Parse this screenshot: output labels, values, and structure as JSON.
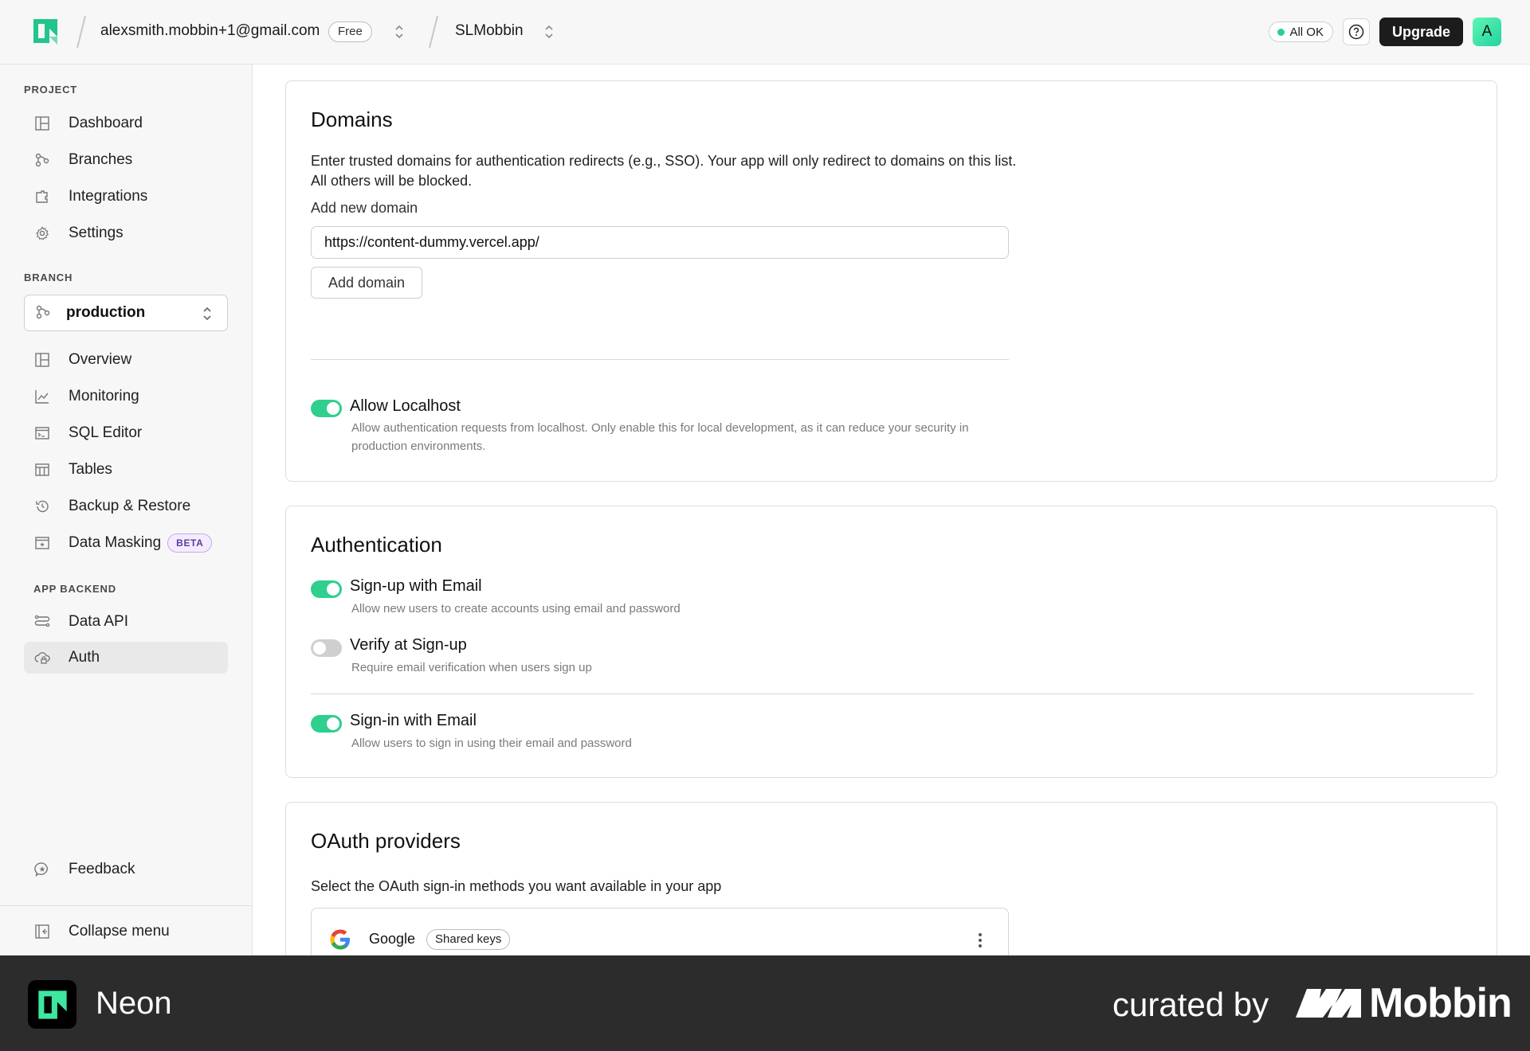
{
  "topbar": {
    "account_email": "alexsmith.mobbin+1@gmail.com",
    "plan_badge": "Free",
    "project_name": "SLMobbin",
    "status_label": "All OK",
    "upgrade_label": "Upgrade",
    "avatar_initial": "A"
  },
  "sidebar": {
    "project_section": "PROJECT",
    "project_items": [
      {
        "label": "Dashboard",
        "icon": "dashboard-icon"
      },
      {
        "label": "Branches",
        "icon": "branches-icon"
      },
      {
        "label": "Integrations",
        "icon": "integrations-icon"
      },
      {
        "label": "Settings",
        "icon": "gear-icon"
      }
    ],
    "branch_section": "BRANCH",
    "branch_selected": "production",
    "branch_items": [
      {
        "label": "Overview",
        "icon": "overview-icon"
      },
      {
        "label": "Monitoring",
        "icon": "chart-icon"
      },
      {
        "label": "SQL Editor",
        "icon": "terminal-icon"
      },
      {
        "label": "Tables",
        "icon": "table-icon"
      },
      {
        "label": "Backup & Restore",
        "icon": "history-icon"
      },
      {
        "label": "Data Masking",
        "icon": "mask-icon",
        "badge": "BETA"
      }
    ],
    "backend_section": "APP BACKEND",
    "backend_items": [
      {
        "label": "Data API",
        "icon": "api-icon"
      },
      {
        "label": "Auth",
        "icon": "cloud-lock-icon",
        "active": true
      }
    ],
    "feedback_label": "Feedback",
    "collapse_label": "Collapse menu"
  },
  "domains": {
    "title": "Domains",
    "description": "Enter trusted domains for authentication redirects (e.g., SSO). Your app will only redirect to domains on this list. All others will be blocked.",
    "field_label": "Add new domain",
    "input_value": "https://content-dummy.vercel.app/",
    "add_button": "Add domain",
    "localhost_label": "Allow Localhost",
    "localhost_desc": "Allow authentication requests from localhost. Only enable this for local development, as it can reduce your security in production environments.",
    "localhost_on": true
  },
  "authentication": {
    "title": "Authentication",
    "options": [
      {
        "label": "Sign-up with Email",
        "desc": "Allow new users to create accounts using email and password",
        "on": true
      },
      {
        "label": "Verify at Sign-up",
        "desc": "Require email verification when users sign up",
        "on": false
      },
      {
        "label": "Sign-in with Email",
        "desc": "Allow users to sign in using their email and password",
        "on": true
      }
    ]
  },
  "oauth": {
    "title": "OAuth providers",
    "description": "Select the OAuth sign-in methods you want available in your app",
    "providers": [
      {
        "name": "Google",
        "badge": "Shared keys"
      }
    ]
  },
  "footer": {
    "app_name": "Neon",
    "curated_by": "curated by",
    "brand": "Mobbin"
  },
  "colors": {
    "accent_green": "#2fcf8e",
    "dark": "#1c1c1c",
    "beta_purple": "#5b3aa0"
  }
}
